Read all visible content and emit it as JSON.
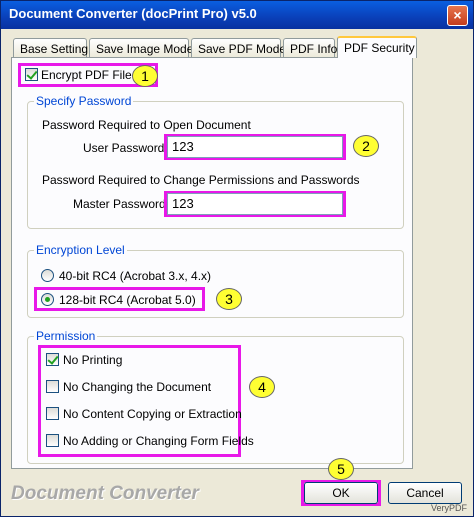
{
  "window": {
    "title": "Document Converter (docPrint Pro) v5.0",
    "close_glyph": "×"
  },
  "tabs": [
    {
      "label": "Base Setting"
    },
    {
      "label": "Save Image Mode"
    },
    {
      "label": "Save PDF Mode"
    },
    {
      "label": "PDF Info"
    },
    {
      "label": "PDF Security"
    }
  ],
  "encrypt": {
    "label": "Encrypt PDF File",
    "checked": true
  },
  "password": {
    "group_label": "Specify Password",
    "open_heading": "Password Required to Open Document",
    "user_label": "User Password:",
    "user_value": "123",
    "change_heading": "Password Required to Change Permissions and Passwords",
    "master_label": "Master Password:",
    "master_value": "123"
  },
  "encryption": {
    "group_label": "Encryption Level",
    "options": [
      {
        "label": "40-bit RC4 (Acrobat 3.x, 4.x)",
        "selected": false
      },
      {
        "label": "128-bit RC4 (Acrobat 5.0)",
        "selected": true
      }
    ]
  },
  "permission": {
    "group_label": "Permission",
    "items": [
      {
        "label": "No Printing",
        "checked": true
      },
      {
        "label": "No Changing the Document",
        "checked": false
      },
      {
        "label": "No Content Copying or Extraction",
        "checked": false
      },
      {
        "label": "No Adding or Changing Form Fields",
        "checked": false
      }
    ]
  },
  "badges": [
    "1",
    "2",
    "3",
    "4",
    "5"
  ],
  "footer": {
    "brand": "Document Converter",
    "ok_label": "OK",
    "cancel_label": "Cancel",
    "watermark": "VeryPDF"
  },
  "colors": {
    "highlight": "#e818e8",
    "badge": "#ffff33",
    "group_label": "#0046d5"
  }
}
